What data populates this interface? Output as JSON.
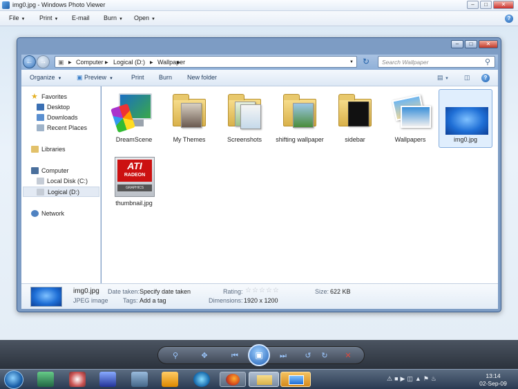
{
  "viewer": {
    "title": "img0.jpg - Windows Photo Viewer",
    "menu": [
      {
        "label": "File",
        "dropdown": true
      },
      {
        "label": "Print",
        "dropdown": true
      },
      {
        "label": "E-mail",
        "dropdown": false
      },
      {
        "label": "Burn",
        "dropdown": true
      },
      {
        "label": "Open",
        "dropdown": true
      }
    ],
    "help_glyph": "?"
  },
  "explorer": {
    "breadcrumb": [
      "Computer",
      "Logical (D:)",
      "Wallpaper"
    ],
    "search_placeholder": "Search Wallpaper",
    "toolbar": {
      "organize": "Organize",
      "preview": "Preview",
      "print": "Print",
      "burn": "Burn",
      "new_folder": "New folder"
    },
    "nav": {
      "favorites": "Favorites",
      "desktop": "Desktop",
      "downloads": "Downloads",
      "recent": "Recent Places",
      "libraries": "Libraries",
      "computer": "Computer",
      "local_c": "Local Disk (C:)",
      "logical_d": "Logical (D:)",
      "network": "Network"
    },
    "items": [
      {
        "label": "DreamScene",
        "kind": "app"
      },
      {
        "label": "My Themes",
        "kind": "folder"
      },
      {
        "label": "Screenshots",
        "kind": "folder"
      },
      {
        "label": "shifting wallpaper",
        "kind": "folder"
      },
      {
        "label": "sidebar",
        "kind": "folder"
      },
      {
        "label": "Wallpapers",
        "kind": "app"
      },
      {
        "label": "img0.jpg",
        "kind": "image",
        "selected": true
      },
      {
        "label": "thumbnail.jpg",
        "kind": "image"
      }
    ],
    "details": {
      "filename": "img0.jpg",
      "filetype": "JPEG image",
      "date_label": "Date taken:",
      "date_value": "Specify date taken",
      "tags_label": "Tags:",
      "tags_value": "Add a tag",
      "rating_label": "Rating:",
      "rating_stars": 0,
      "dimensions_label": "Dimensions:",
      "dimensions_value": "1920 x 1200",
      "size_label": "Size:",
      "size_value": "622 KB"
    },
    "ati_logo": {
      "brand": "ATI",
      "line2": "RADEON",
      "line3": "GRAPHICS"
    }
  },
  "taskbar": {
    "time": "13:14",
    "date": "02-Sep-09"
  },
  "colors": {
    "accent": "#3b77bd",
    "selection": "#cbe2fc",
    "close_red": "#c9302c"
  }
}
